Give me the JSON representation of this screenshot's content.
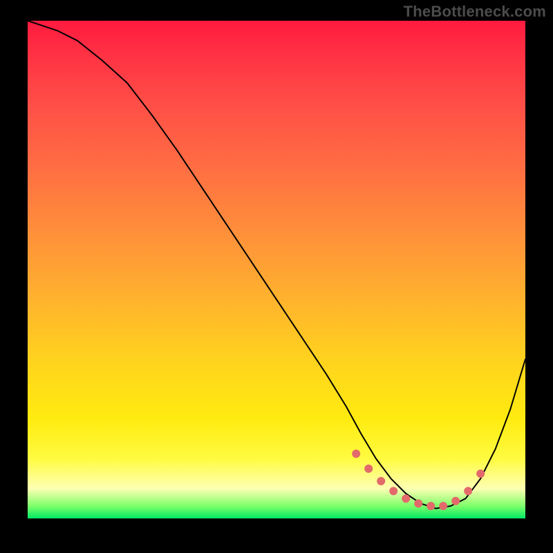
{
  "watermark": "TheBottleneck.com",
  "chart_data": {
    "type": "line",
    "title": "",
    "xlabel": "",
    "ylabel": "",
    "xlim": [
      0,
      100
    ],
    "ylim": [
      0,
      100
    ],
    "grid": false,
    "legend": false,
    "background_gradient": {
      "orientation": "vertical",
      "stops": [
        {
          "pos": 0.0,
          "color": "#ff1a3f"
        },
        {
          "pos": 0.3,
          "color": "#ff6f42"
        },
        {
          "pos": 0.55,
          "color": "#ffb02e"
        },
        {
          "pos": 0.8,
          "color": "#ffeb0f"
        },
        {
          "pos": 0.94,
          "color": "#fdffb3"
        },
        {
          "pos": 1.0,
          "color": "#00e765"
        }
      ]
    },
    "series": [
      {
        "name": "bottleneck-curve",
        "x": [
          0,
          3,
          6,
          10,
          15,
          20,
          25,
          30,
          35,
          40,
          45,
          50,
          55,
          60,
          64,
          67,
          70,
          73,
          76,
          79,
          82,
          85,
          88,
          91,
          94,
          97,
          100
        ],
        "y": [
          100,
          99,
          98,
          96,
          92,
          87.5,
          81,
          74,
          66.5,
          59,
          51.5,
          44,
          36.5,
          29,
          22.5,
          17,
          12,
          8,
          5,
          3,
          2,
          2.5,
          4,
          8,
          14,
          22,
          32
        ]
      }
    ],
    "markers": {
      "name": "optimal-range-dots",
      "color": "#e26a6a",
      "radius_px": 6,
      "x": [
        66,
        68.5,
        71,
        73.5,
        76,
        78.5,
        81,
        83.5,
        86,
        88.5,
        91
      ],
      "y": [
        13,
        10,
        7.5,
        5.5,
        4,
        3,
        2.5,
        2.5,
        3.5,
        5.5,
        9
      ]
    }
  }
}
